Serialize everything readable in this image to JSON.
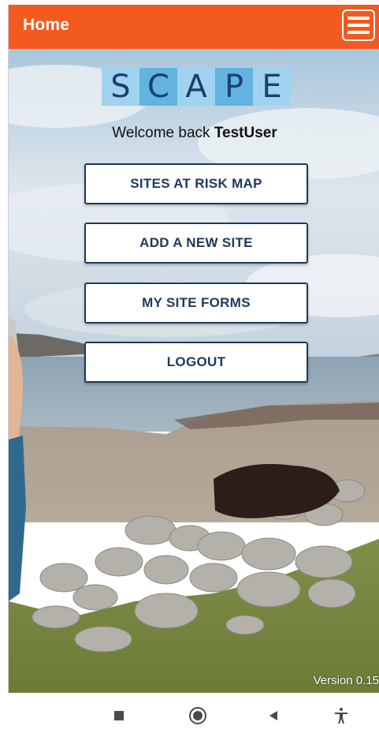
{
  "header": {
    "title": "Home",
    "color": "#f35a1f",
    "menu_icon": "hamburger-menu-icon"
  },
  "logo": {
    "letters": [
      "S",
      "C",
      "A",
      "P",
      "E"
    ]
  },
  "welcome": {
    "prefix": "Welcome back ",
    "username": "TestUser"
  },
  "buttons": [
    {
      "label": "SITES AT RISK MAP"
    },
    {
      "label": "ADD A NEW SITE"
    },
    {
      "label": "MY SITE FORMS"
    },
    {
      "label": "LOGOUT"
    }
  ],
  "version": "Version 0.15",
  "navbar": {
    "icons": [
      "recent-apps-icon",
      "home-icon",
      "back-icon",
      "accessibility-icon"
    ]
  },
  "colors": {
    "accent": "#f35a1f",
    "button_text": "#1d3a5c",
    "logo_light": "#9fd3ef",
    "logo_dark": "#62b3e0"
  }
}
